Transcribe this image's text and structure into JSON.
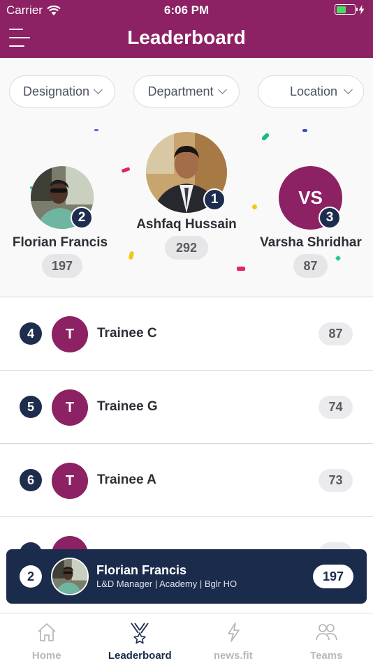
{
  "status_bar": {
    "carrier": "Carrier",
    "time": "6:06 PM"
  },
  "header": {
    "title": "Leaderboard"
  },
  "filters": [
    {
      "label": "Designation"
    },
    {
      "label": "Department"
    },
    {
      "label": "Location"
    }
  ],
  "podium": {
    "first": {
      "rank": "1",
      "name": "Ashfaq  Hussain",
      "score": "292"
    },
    "second": {
      "rank": "2",
      "name": "Florian Francis",
      "score": "197"
    },
    "third": {
      "rank": "3",
      "name": "Varsha Shridhar",
      "score": "87",
      "initials": "VS"
    }
  },
  "list": [
    {
      "rank": "4",
      "initial": "T",
      "name": "Trainee C",
      "score": "87"
    },
    {
      "rank": "5",
      "initial": "T",
      "name": "Trainee G",
      "score": "74"
    },
    {
      "rank": "6",
      "initial": "T",
      "name": "Trainee A",
      "score": "73"
    }
  ],
  "current_user": {
    "rank": "2",
    "name": "Florian Francis",
    "subtitle": "L&D Manager | Academy | Bglr HO",
    "score": "197"
  },
  "tabs": [
    {
      "label": "Home",
      "icon": "home-icon",
      "active": false
    },
    {
      "label": "Leaderboard",
      "icon": "medal-icon",
      "active": true
    },
    {
      "label": "news.fit",
      "icon": "lightning-icon",
      "active": false
    },
    {
      "label": "Teams",
      "icon": "people-icon",
      "active": false
    }
  ],
  "colors": {
    "brand": "#8c2163",
    "navy": "#1e2d4d",
    "pill": "#e6e6e8"
  }
}
